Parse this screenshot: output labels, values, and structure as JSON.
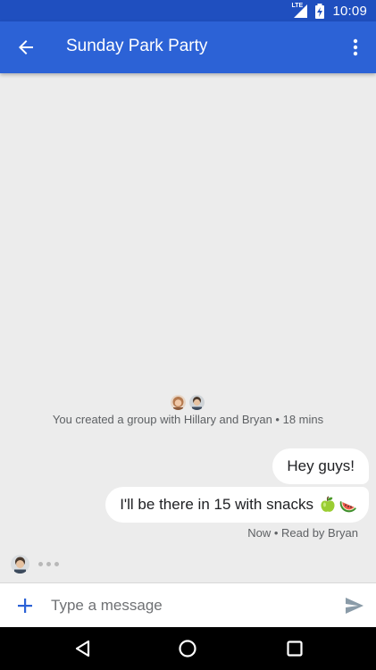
{
  "status_bar": {
    "network": "LTE",
    "time": "10:09"
  },
  "app_bar": {
    "title": "Sunday Park Party",
    "icons": {
      "back": "back-arrow-icon",
      "more": "more-vert-icon"
    }
  },
  "conversation": {
    "system_message": "You created a group with Hillary and Bryan • 18 mins",
    "messages": [
      {
        "text": "Hey guys!"
      },
      {
        "text": "I'll be there in 15 with snacks",
        "emoji": [
          "green-apple-icon",
          "watermelon-icon"
        ]
      }
    ],
    "meta": "Now • Read by Bryan"
  },
  "compose": {
    "placeholder": "Type a message",
    "icons": {
      "add": "plus-icon",
      "send": "send-icon"
    }
  },
  "colors": {
    "status_bar": "#1f4fbf",
    "app_bar": "#2c62d6",
    "background": "#ececec",
    "bubble": "#ffffff",
    "accent": "#2c62d6",
    "nav_bar": "#000000"
  }
}
